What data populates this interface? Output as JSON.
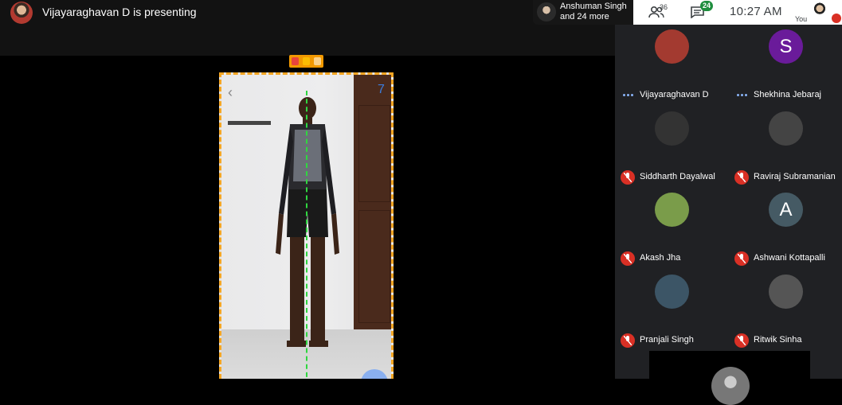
{
  "presentation": {
    "presenter_text": "Vijayaraghavan D is presenting",
    "share_indicator_count": "7"
  },
  "participants_pill": {
    "line1": "Anshuman Singh",
    "line2": "and 24 more"
  },
  "controls": {
    "people_count": "36",
    "chat_unread": "24",
    "time": "10:27  AM",
    "self_label": "You"
  },
  "colors": {
    "mute_red": "#d93025",
    "chat_badge": "#1e8e3e",
    "share_orange": "#f29900",
    "tile_bg": "#202124"
  },
  "tiles": [
    {
      "name": "Vijayaraghavan D",
      "status": "speaking",
      "avatar_letter": "",
      "avatar_color": "#a33a30"
    },
    {
      "name": "Shekhina Jebaraj",
      "status": "speaking",
      "avatar_letter": "S",
      "avatar_color": "#6a1b9a"
    },
    {
      "name": "Siddharth Dayalwal",
      "status": "muted",
      "avatar_letter": "",
      "avatar_color": "#333"
    },
    {
      "name": "Raviraj Subramanian",
      "status": "muted",
      "avatar_letter": "",
      "avatar_color": "#444"
    },
    {
      "name": "Akash Jha",
      "status": "muted",
      "avatar_letter": "",
      "avatar_color": "#7a9c4a"
    },
    {
      "name": "Ashwani Kottapalli",
      "status": "muted",
      "avatar_letter": "A",
      "avatar_color": "#455a64"
    },
    {
      "name": "Pranjali Singh",
      "status": "muted",
      "avatar_letter": "",
      "avatar_color": "#3c5566"
    },
    {
      "name": "Ritwik Sinha",
      "status": "muted",
      "avatar_letter": "",
      "avatar_color": "#555"
    }
  ]
}
